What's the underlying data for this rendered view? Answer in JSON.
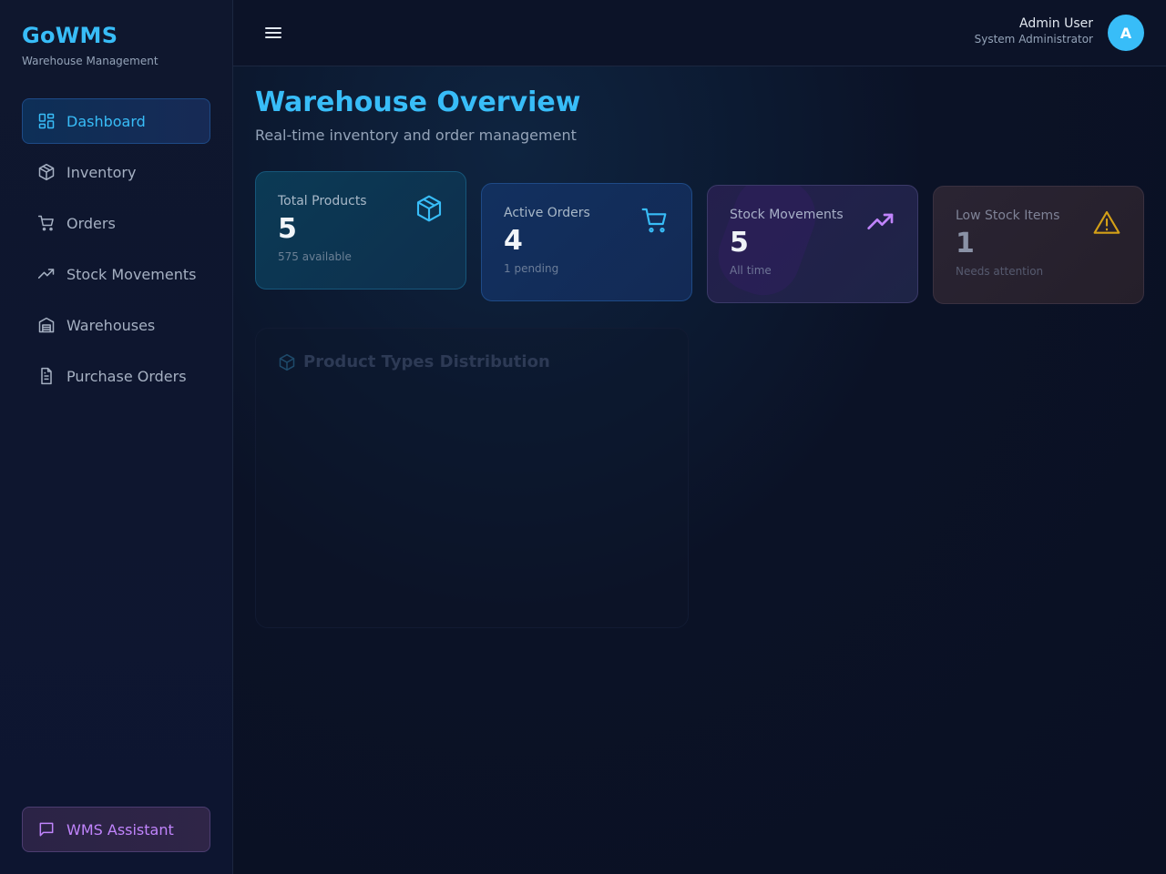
{
  "brand": {
    "title": "GoWMS",
    "subtitle": "Warehouse Management"
  },
  "sidebar": {
    "items": [
      {
        "label": "Dashboard",
        "icon": "dashboard-icon",
        "active": true
      },
      {
        "label": "Inventory",
        "icon": "box-icon"
      },
      {
        "label": "Orders",
        "icon": "cart-icon"
      },
      {
        "label": "Stock Movements",
        "icon": "trending-up-icon"
      },
      {
        "label": "Warehouses",
        "icon": "warehouse-icon"
      },
      {
        "label": "Purchase Orders",
        "icon": "document-icon"
      }
    ],
    "assistant_label": "WMS Assistant"
  },
  "header": {
    "user_name": "Admin User",
    "user_role": "System Administrator",
    "avatar_initial": "A"
  },
  "main": {
    "title": "Warehouse Overview",
    "subtitle": "Real-time inventory and order management",
    "stats": [
      {
        "label": "Total Products",
        "value": "5",
        "note": "575 available",
        "icon": "box-icon"
      },
      {
        "label": "Active Orders",
        "value": "4",
        "note": "1 pending",
        "icon": "cart-icon"
      },
      {
        "label": "Stock Movements",
        "value": "5",
        "note": "All time",
        "icon": "trending-up-icon"
      },
      {
        "label": "Low Stock Items",
        "value": "1",
        "note": "Needs attention",
        "icon": "warning-icon"
      }
    ],
    "panel_title": "Product Types Distribution"
  },
  "colors": {
    "accent": "#38bdf8",
    "purple": "#c084fc",
    "warning": "#d4a017"
  }
}
